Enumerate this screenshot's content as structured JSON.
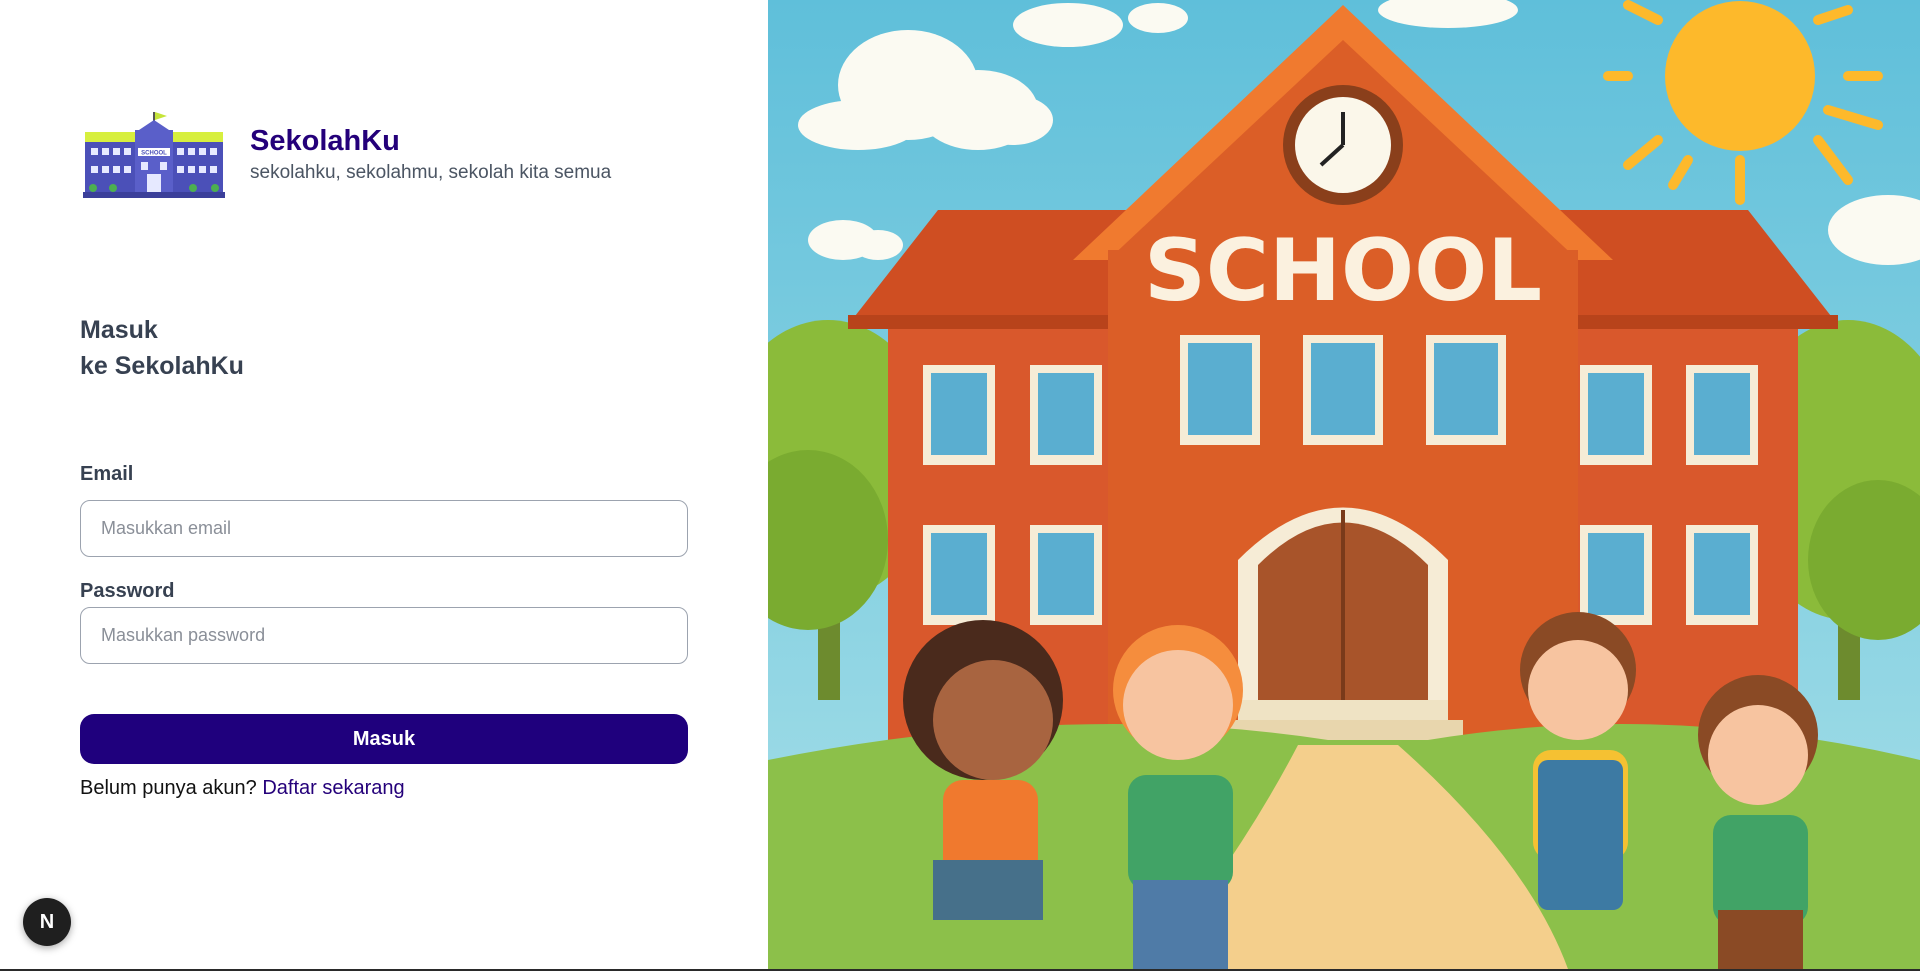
{
  "brand": {
    "name": "SekolahKu",
    "tagline": "sekolahku, sekolahmu, sekolah kita semua",
    "logo_sign": "SCHOOL"
  },
  "heading": {
    "line1": "Masuk",
    "line2": "ke SekolahKu"
  },
  "form": {
    "email_label": "Email",
    "email_placeholder": "Masukkan email",
    "email_value": "",
    "password_label": "Password",
    "password_placeholder": "Masukkan password",
    "password_value": "",
    "submit_label": "Masuk"
  },
  "signup": {
    "prompt": "Belum punya akun?",
    "link_label": "Daftar sekarang"
  },
  "dev_badge": {
    "letter": "N"
  },
  "illustration": {
    "sign_text": "SCHOOL",
    "icon": "school-illustration"
  },
  "colors": {
    "brand": "#24007a",
    "button": "#1f007d",
    "sky": "#7ccbe0",
    "brick": "#d9582c",
    "grass": "#8cc04a"
  }
}
